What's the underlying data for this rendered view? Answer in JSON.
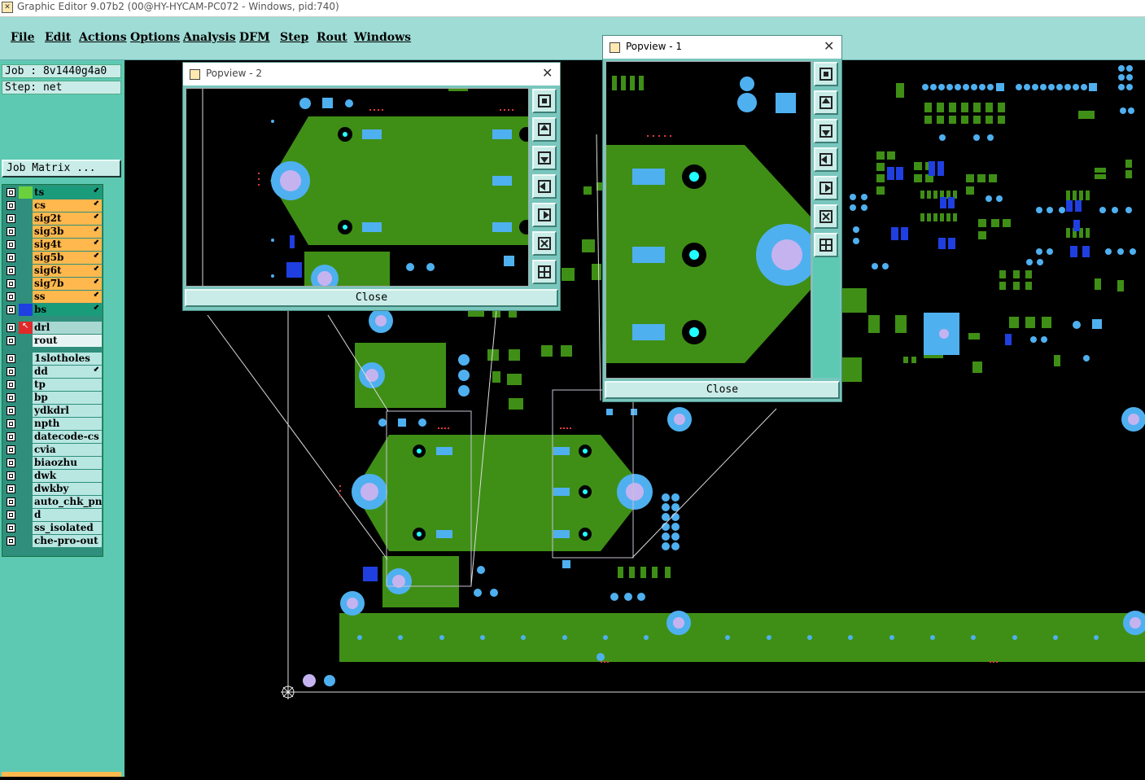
{
  "window": {
    "title": "Graphic Editor 9.07b2 (00@HY-HYCAM-PC072 - Windows, pid:740)"
  },
  "menu": [
    "File",
    "Edit",
    "Actions",
    "Options",
    "Analysis",
    "DFM",
    "Step",
    "Rout",
    "Windows"
  ],
  "job": {
    "job_text": "Job : 8v1440g4a0",
    "step_text": "Step: net",
    "matrix_label": "Job Matrix ..."
  },
  "layers": [
    {
      "name": "ts",
      "color": "#1a9c7a",
      "arrow": true
    },
    {
      "name": "cs",
      "color": "#ffb84d",
      "arrow": true
    },
    {
      "name": "sig2t",
      "color": "#ffb84d",
      "arrow": true
    },
    {
      "name": "sig3b",
      "color": "#ffb84d",
      "arrow": true
    },
    {
      "name": "sig4t",
      "color": "#ffb84d",
      "arrow": true
    },
    {
      "name": "sig5b",
      "color": "#ffb84d",
      "arrow": true
    },
    {
      "name": "sig6t",
      "color": "#ffb84d",
      "arrow": true
    },
    {
      "name": "sig7b",
      "color": "#ffb84d",
      "arrow": true
    },
    {
      "name": "ss",
      "color": "#ffb84d",
      "arrow": true
    },
    {
      "name": "bs",
      "color": "#1a9c7a",
      "arrow": true
    },
    {
      "name": "drl",
      "color": "#a9d8d2",
      "arrow": false
    },
    {
      "name": "rout",
      "color": "#e6f5f3",
      "arrow": false
    },
    {
      "name": "1slotholes",
      "color": "#b8e7e2",
      "arrow": false
    },
    {
      "name": "dd",
      "color": "#b8e7e2",
      "arrow": true
    },
    {
      "name": "tp",
      "color": "#b8e7e2",
      "arrow": false
    },
    {
      "name": "bp",
      "color": "#b8e7e2",
      "arrow": false
    },
    {
      "name": "ydkdrl",
      "color": "#b8e7e2",
      "arrow": false
    },
    {
      "name": "npth",
      "color": "#b8e7e2",
      "arrow": false
    },
    {
      "name": "datecode-cs",
      "color": "#b8e7e2",
      "arrow": false
    },
    {
      "name": "cvia",
      "color": "#b8e7e2",
      "arrow": false
    },
    {
      "name": "biaozhu",
      "color": "#b8e7e2",
      "arrow": false
    },
    {
      "name": "dwk",
      "color": "#b8e7e2",
      "arrow": false
    },
    {
      "name": "dwkby",
      "color": "#b8e7e2",
      "arrow": false
    },
    {
      "name": "auto_chk_pn",
      "color": "#b8e7e2",
      "arrow": false
    },
    {
      "name": "d",
      "color": "#b8e7e2",
      "arrow": false
    },
    {
      "name": "ss_isolated",
      "color": "#b8e7e2",
      "arrow": false
    },
    {
      "name": "che-pro-out",
      "color": "#b8e7e2",
      "arrow": false
    }
  ],
  "popview2": {
    "title": "Popview - 2",
    "close_label": "Close"
  },
  "popview1": {
    "title": "Popview - 1",
    "close_label": "Close"
  },
  "colors": {
    "board_green": "#3f8f16",
    "pad_blue": "#4fb0f0",
    "via_light": "#c5b3f0",
    "trace_dark_blue": "#1f3fe0"
  }
}
